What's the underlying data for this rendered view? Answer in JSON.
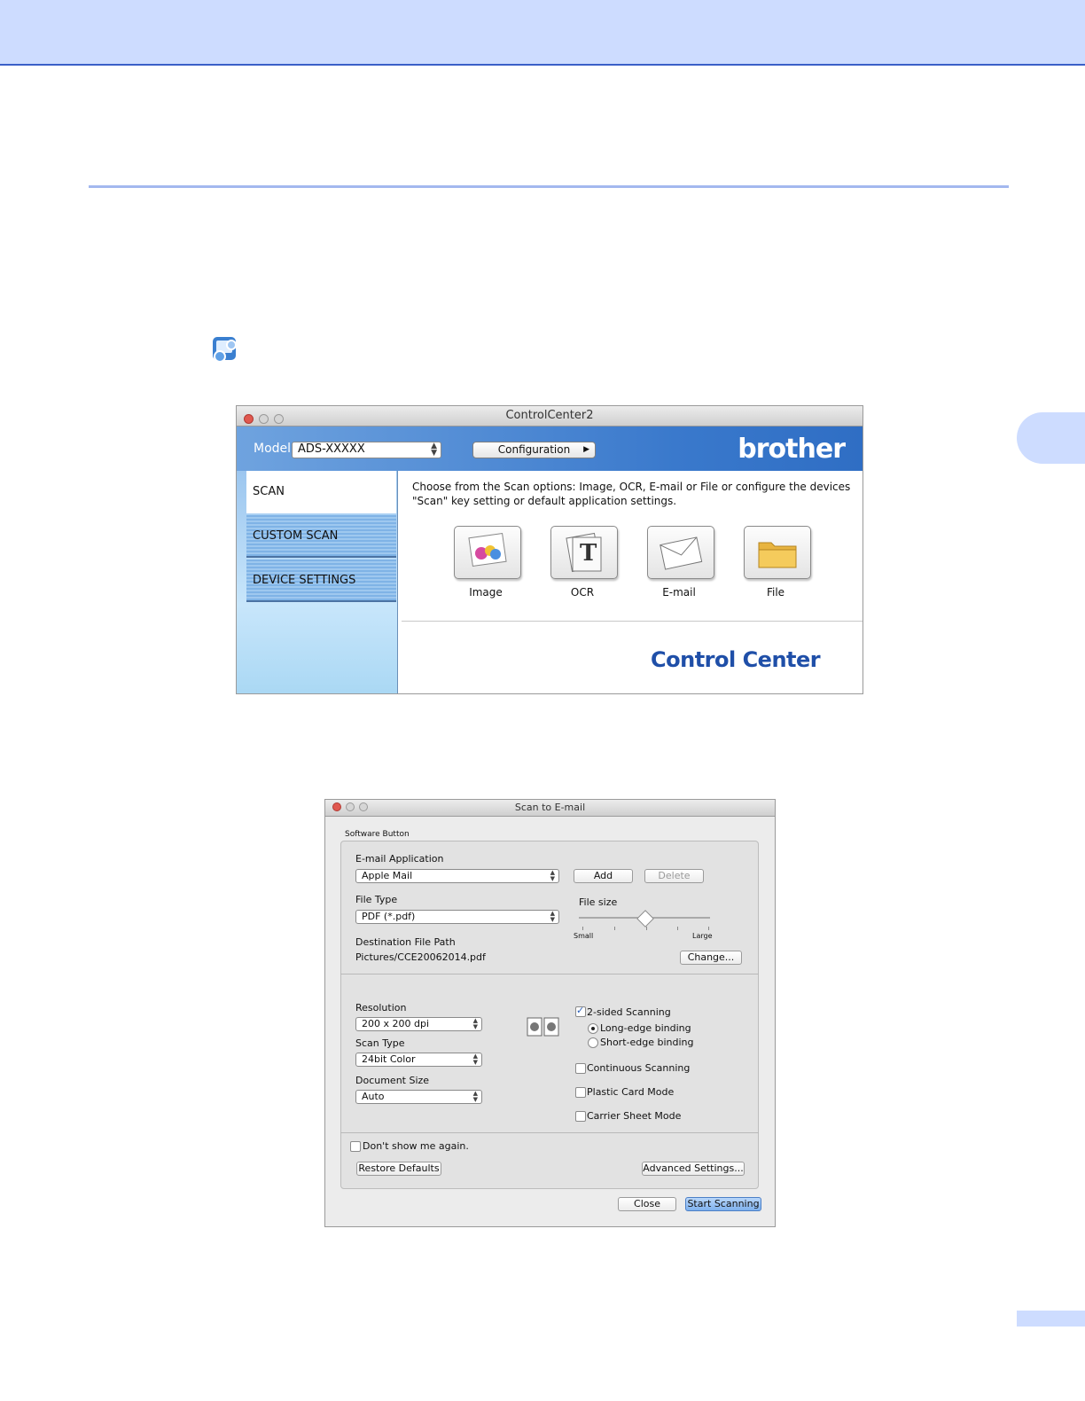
{
  "controlcenter": {
    "title": "ControlCenter2",
    "model_label": "Model",
    "model_value": "ADS-XXXXX",
    "configuration_label": "Configuration",
    "brand_logo": "brother",
    "sidebar": [
      {
        "label": "SCAN"
      },
      {
        "label": "CUSTOM SCAN"
      },
      {
        "label": "DEVICE SETTINGS"
      }
    ],
    "description": "Choose from the Scan options: Image, OCR, E-mail or File or configure the devices \"Scan\" key setting or default application settings.",
    "scan_options": [
      {
        "label": "Image",
        "icon": "image-scan-icon"
      },
      {
        "label": "OCR",
        "icon": "ocr-scan-icon"
      },
      {
        "label": "E-mail",
        "icon": "email-scan-icon"
      },
      {
        "label": "File",
        "icon": "folder-scan-icon"
      }
    ],
    "footer_logo": "Control Center"
  },
  "dialog": {
    "title": "Scan to E-mail",
    "group_label": "Software Button",
    "email_application_label": "E-mail Application",
    "email_application_value": "Apple Mail",
    "add_label": "Add",
    "delete_label": "Delete",
    "file_type_label": "File Type",
    "file_type_value": "PDF (*.pdf)",
    "file_size_label": "File size",
    "file_size_level": 0.5,
    "file_size_min_label": "Small",
    "file_size_max_label": "Large",
    "destination_label": "Destination File Path",
    "destination_value": "Pictures/CCE20062014.pdf",
    "change_label": "Change...",
    "resolution_label": "Resolution",
    "resolution_value": "200 x 200 dpi",
    "scan_type_label": "Scan Type",
    "scan_type_value": "24bit Color",
    "document_size_label": "Document Size",
    "document_size_value": "Auto",
    "two_sided_label": "2-sided Scanning",
    "two_sided_checked": true,
    "long_edge_label": "Long-edge binding",
    "short_edge_label": "Short-edge binding",
    "continuous_label": "Continuous Scanning",
    "plastic_card_label": "Plastic Card Mode",
    "carrier_sheet_label": "Carrier Sheet Mode",
    "dont_show_label": "Don't show me again.",
    "restore_defaults_label": "Restore Defaults",
    "advanced_settings_label": "Advanced Settings...",
    "close_label": "Close",
    "start_scanning_label": "Start Scanning"
  }
}
